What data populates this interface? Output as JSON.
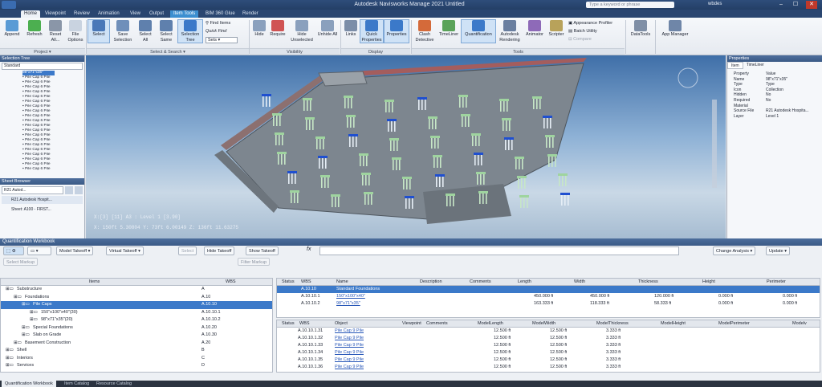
{
  "titlebar": {
    "title": "Autodesk Navisworks Manage 2021    Untitled",
    "search_placeholder": "Type a keyword or phrase",
    "user": "wbdes",
    "min": "–",
    "max": "☐",
    "close": "✕"
  },
  "tabs": [
    "Home",
    "Viewpoint",
    "Review",
    "Animation",
    "View",
    "Output",
    "Item Tools",
    "BIM 360 Glue",
    "Render"
  ],
  "ribbon": {
    "project": {
      "label": "Project ▾",
      "buttons": [
        "Append",
        "Refresh",
        "Reset All...",
        "File Options"
      ]
    },
    "select_search": {
      "label": "Select & Search ▾",
      "buttons": [
        "Select",
        "Save Selection",
        "Select All",
        "Select Same",
        "Selection Tree"
      ],
      "find_items": "Find Items",
      "quick_find": "Quick Find",
      "sets": "Sets"
    },
    "visibility": {
      "label": "Visibility",
      "buttons": [
        "Hide",
        "Require",
        "Hide Unselected",
        "Unhide All"
      ]
    },
    "display": {
      "label": "Display",
      "buttons": [
        "Links",
        "Quick Properties",
        "Properties"
      ]
    },
    "tools": {
      "label": "Tools",
      "buttons": [
        "Clash Detective",
        "TimeLiner",
        "Quantification",
        "Autodesk Rendering",
        "Animator",
        "Scripter"
      ],
      "small": [
        "Appearance Profiler",
        "Batch Utility",
        "Compare"
      ]
    },
    "extra": [
      "DataTools",
      "App Manager"
    ]
  },
  "left": {
    "selection_tree_title": "Selection Tree",
    "standard": "Standard",
    "tree_first": "98\"x71\"x35\"",
    "tree_item": "Pile Cap 6 Pile",
    "sheet_browser_title": "Sheet Browser",
    "sheet_search": "R21 Autod...",
    "sheets": [
      "R21 Autodesk Hospit...",
      "Sheet: A100 - FIRST..."
    ]
  },
  "viewport": {
    "hud_line1": "X:[3] [11] A3 : Level 1 [3.90]",
    "hud_line2": "X: 150ft 5.30804  Y: 73ft 6.00149  Z: 136ft 11.63275"
  },
  "properties": {
    "title": "Properties",
    "tabs": [
      "Item",
      "TimeLiner"
    ],
    "rows": [
      [
        "Property",
        "Value"
      ],
      [
        "Name",
        "98\"x71\"x35\""
      ],
      [
        "Type",
        "Type"
      ],
      [
        "Icon",
        "Collection"
      ],
      [
        "Hidden",
        "No"
      ],
      [
        "Required",
        "No"
      ],
      [
        "Material",
        ""
      ],
      [
        "Source File",
        "R21 Autodesk Hospita..."
      ],
      [
        "Layer",
        "Level 1"
      ]
    ]
  },
  "workbook": {
    "title": "Quantification Workbook",
    "toolbar": [
      "Model Takeoff ▾",
      "Virtual Takeoff ▾",
      "Select",
      "Hide Takeoff",
      "Show Takeoff",
      "Change Analysis ▾",
      "Update ▾"
    ],
    "toolbar2": [
      "Select Markup",
      "Filter Markup"
    ],
    "fx": "fx",
    "tree_headers": [
      "Items",
      "WBS"
    ],
    "tree": [
      {
        "name": "Substructure",
        "wbs": "A",
        "indent": 0
      },
      {
        "name": "Foundations",
        "wbs": "A.10",
        "indent": 1
      },
      {
        "name": "Pile Caps",
        "wbs": "A.10.10",
        "indent": 2
      },
      {
        "name": "150\"x100\"x40\"(30)",
        "wbs": "A.10.10.1",
        "indent": 3
      },
      {
        "name": "98\"x71\"x35\"(20)",
        "wbs": "A.10.10.2",
        "indent": 3
      },
      {
        "name": "Special Foundations",
        "wbs": "A.10.20",
        "indent": 2
      },
      {
        "name": "Slab on Grade",
        "wbs": "A.10.30",
        "indent": 2
      },
      {
        "name": "Basement Construction",
        "wbs": "A.20",
        "indent": 1
      },
      {
        "name": "Shell",
        "wbs": "B",
        "indent": 0
      },
      {
        "name": "Interiors",
        "wbs": "C",
        "indent": 0
      },
      {
        "name": "Services",
        "wbs": "D",
        "indent": 0
      }
    ],
    "upper_headers": [
      "Status",
      "WBS",
      "Name",
      "Description",
      "Comments",
      "Length",
      "Width",
      "Thickness",
      "Height",
      "Perimeter"
    ],
    "upper_rows": [
      [
        "",
        "A.10.10",
        "Standard Foundations",
        "",
        "",
        "",
        "",
        "",
        "",
        ""
      ],
      [
        "",
        "A.10.10.1",
        "150\"x100\"x40\"",
        "",
        "",
        "450.000 ft",
        "450.000 ft",
        "120.000 ft",
        "0.000 ft",
        "0.000 ft"
      ],
      [
        "",
        "A.10.10.2",
        "98\"x71\"x35\"",
        "",
        "",
        "163.333 ft",
        "118.333 ft",
        "58.333 ft",
        "0.000 ft",
        "0.000 ft"
      ]
    ],
    "lower_headers": [
      "Status",
      "WBS",
      "Object",
      "Viewpoint",
      "Comments",
      "ModelLength",
      "ModelWidth",
      "ModelThickness",
      "ModelHeight",
      "ModelPerimeter",
      "Modelv"
    ],
    "lower_rows": [
      [
        "A.10.10.1.31",
        "Pile Cap 9 Pile",
        "12.500 ft",
        "12.500 ft",
        "3.333 ft"
      ],
      [
        "A.10.10.1.32",
        "Pile Cap 9 Pile",
        "12.500 ft",
        "12.500 ft",
        "3.333 ft"
      ],
      [
        "A.10.10.1.33",
        "Pile Cap 9 Pile",
        "12.500 ft",
        "12.500 ft",
        "3.333 ft"
      ],
      [
        "A.10.10.1.34",
        "Pile Cap 9 Pile",
        "12.500 ft",
        "12.500 ft",
        "3.333 ft"
      ],
      [
        "A.10.10.1.35",
        "Pile Cap 9 Pile",
        "12.500 ft",
        "12.500 ft",
        "3.333 ft"
      ],
      [
        "A.10.10.1.36",
        "Pile Cap 9 Pile",
        "12.500 ft",
        "12.500 ft",
        "3.333 ft"
      ]
    ]
  },
  "status_tabs": [
    "Quantification Workbook",
    "Item Catalog",
    "Resource Catalog"
  ],
  "colors": {
    "accent": "#3c8fd0",
    "selected": "#3b79c9",
    "header": "#3b5a86"
  }
}
